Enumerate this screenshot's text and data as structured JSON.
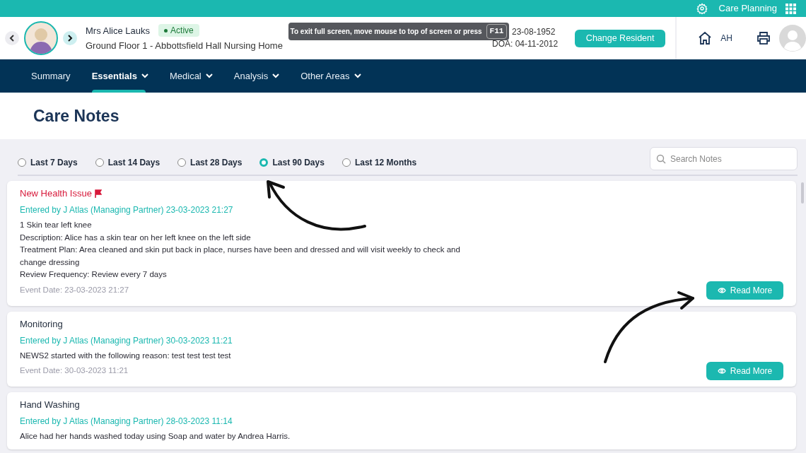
{
  "top_bar": {
    "app_name": "Care Planning"
  },
  "resident": {
    "name": "Mrs Alice Lauks",
    "status": "Active",
    "location": "Ground Floor 1 - Abbottsfield Hall Nursing Home",
    "dob": "23-08-1952",
    "doa": "DOA: 04-11-2012",
    "change_button": "Change Resident"
  },
  "user": {
    "initials": "AH"
  },
  "toast": {
    "message": "To exit full screen, move mouse to top of screen or press",
    "key": "F11"
  },
  "nav": [
    {
      "label": "Summary",
      "selected": false,
      "dropdown": false
    },
    {
      "label": "Essentials",
      "selected": true,
      "dropdown": true
    },
    {
      "label": "Medical",
      "selected": false,
      "dropdown": true
    },
    {
      "label": "Analysis",
      "selected": false,
      "dropdown": true
    },
    {
      "label": "Other Areas",
      "selected": false,
      "dropdown": true
    }
  ],
  "page_title": "Care Notes",
  "filters": [
    {
      "label": "Last 7 Days",
      "selected": false
    },
    {
      "label": "Last 14 Days",
      "selected": false
    },
    {
      "label": "Last 28 Days",
      "selected": false
    },
    {
      "label": "Last 90 Days",
      "selected": true
    },
    {
      "label": "Last 12 Months",
      "selected": false
    }
  ],
  "search": {
    "placeholder": "Search Notes"
  },
  "notes": [
    {
      "title": "New Health Issue",
      "flagged": true,
      "entered_by": "Entered by J Atlas (Managing Partner) 23-03-2023 21:27",
      "body": [
        "1 Skin tear left knee",
        "Description: Alice has a skin tear on her left knee on the left side",
        "Treatment Plan: Area cleaned and skin put back in place, nurses have been and dressed and will visit weekly to check and change dressing",
        "Review Frequency: Review every 7 days"
      ],
      "event_date": "Event Date: 23-03-2023 21:27",
      "button": "Read More"
    },
    {
      "title": "Monitoring",
      "flagged": false,
      "entered_by": "Entered by J Atlas (Managing Partner) 30-03-2023 11:21",
      "body": [
        "NEWS2 started with the following reason: test test test test"
      ],
      "event_date": "Event Date: 30-03-2023 11:21",
      "button": "Read More"
    },
    {
      "title": "Hand Washing",
      "flagged": false,
      "entered_by": "Entered by J Atlas (Managing Partner) 28-03-2023 11:14",
      "body": [
        "Alice had her hands washed today using Soap and water by Andrea Harris."
      ]
    }
  ]
}
